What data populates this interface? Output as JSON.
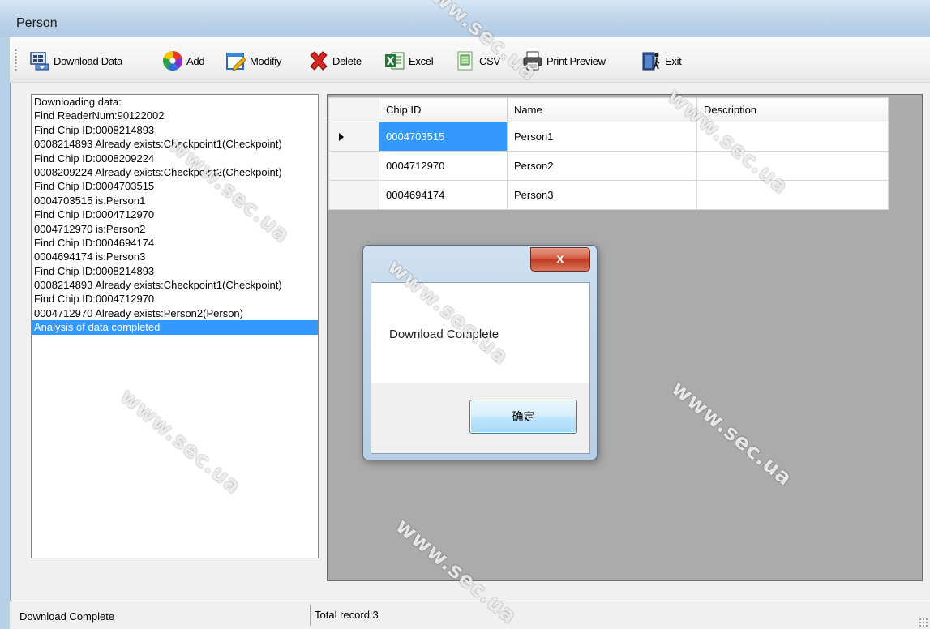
{
  "window": {
    "title": "Person"
  },
  "toolbar": {
    "buttons": [
      {
        "label": "Download Data",
        "icon": "download-data-icon"
      },
      {
        "label": "Add",
        "icon": "color-wheel-icon"
      },
      {
        "label": "Modifiy",
        "icon": "edit-icon"
      },
      {
        "label": "Delete",
        "icon": "red-x-icon"
      },
      {
        "label": "Excel",
        "icon": "excel-icon"
      },
      {
        "label": "CSV",
        "icon": "csv-icon"
      },
      {
        "label": "Print Preview",
        "icon": "printer-icon"
      },
      {
        "label": "Exit",
        "icon": "exit-icon"
      }
    ]
  },
  "log": {
    "lines": [
      "Downloading data:",
      "Find ReaderNum:90122002",
      "Find Chip ID:0008214893",
      "0008214893 Already exists:Checkpoint1(Checkpoint)",
      "Find Chip ID:0008209224",
      "0008209224 Already exists:Checkpoint2(Checkpoint)",
      "Find Chip ID:0004703515",
      "0004703515 is:Person1",
      "Find Chip ID:0004712970",
      "0004712970 is:Person2",
      "Find Chip ID:0004694174",
      "0004694174 is:Person3",
      "Find Chip ID:0008214893",
      "0008214893 Already exists:Checkpoint1(Checkpoint)",
      "Find Chip ID:0004712970",
      "0004712970 Already exists:Person2(Person)",
      "Analysis of data completed"
    ],
    "selected_index": 16
  },
  "grid": {
    "columns": [
      "Chip ID",
      "Name",
      "Description"
    ],
    "rows": [
      [
        "0004703515",
        "Person1",
        ""
      ],
      [
        "0004712970",
        "Person2",
        ""
      ],
      [
        "0004694174",
        "Person3",
        ""
      ]
    ]
  },
  "dialog": {
    "message": "Download Complete",
    "ok_label": "确定",
    "close_label": "x"
  },
  "status": {
    "left": "Download Complete",
    "right": "Total record:3"
  },
  "watermark": {
    "text": "www.sec.ua"
  },
  "colors": {
    "selection": "#3399ff",
    "grid_bg": "#ababab"
  }
}
